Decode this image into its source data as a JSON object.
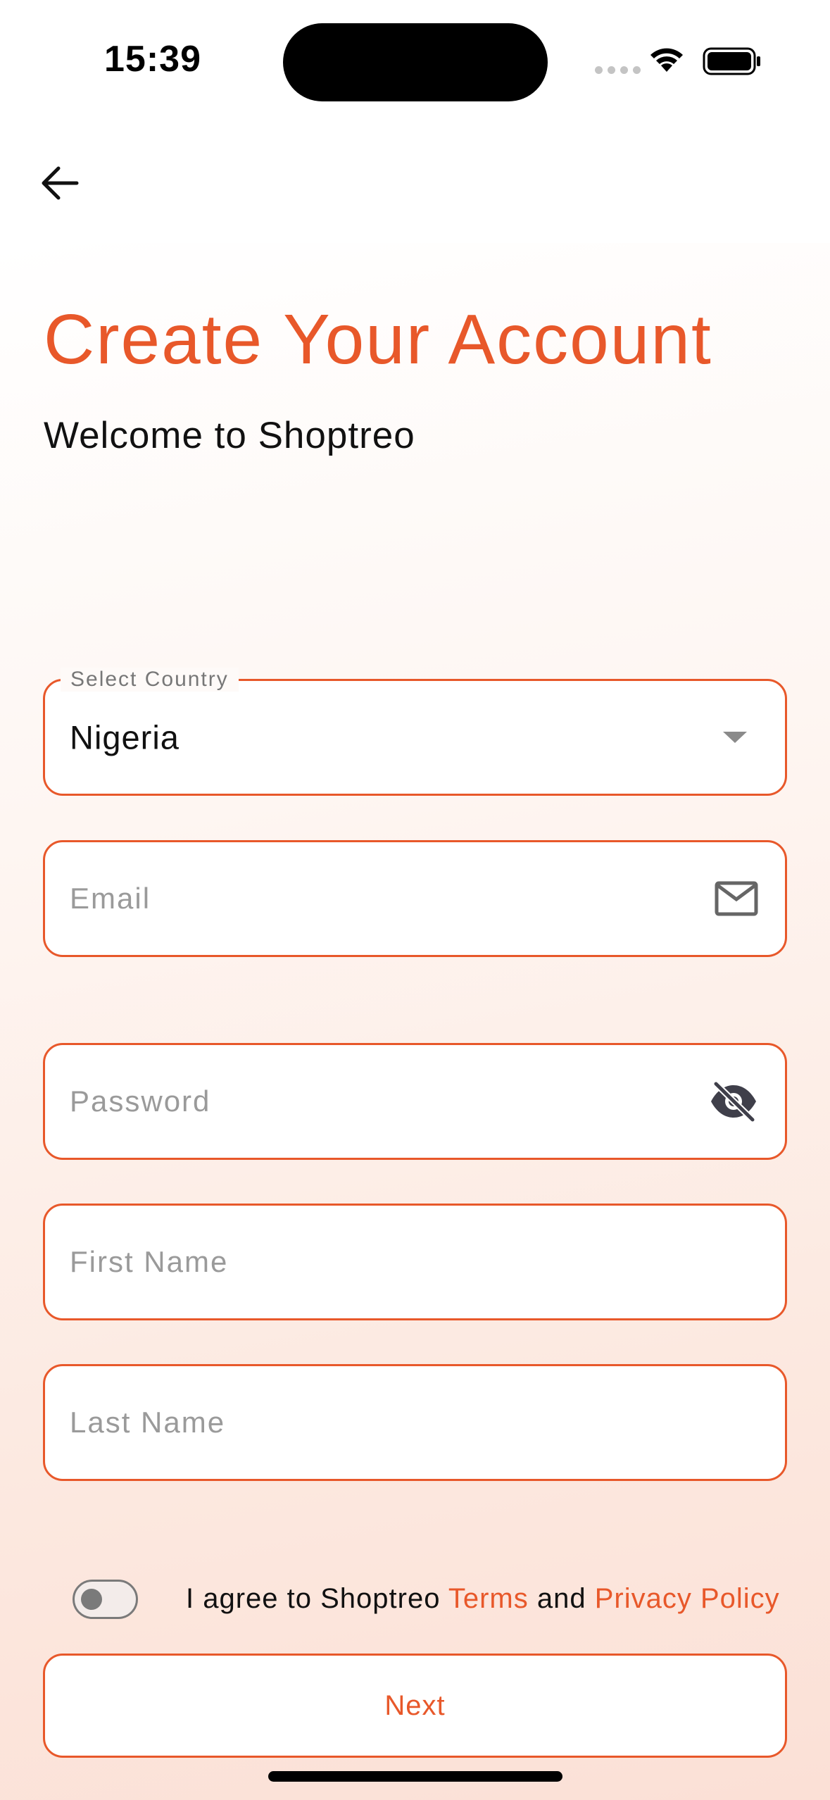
{
  "status_bar": {
    "time": "15:39"
  },
  "header": {
    "back_icon": "arrow-left-icon"
  },
  "page": {
    "title": "Create Your Account",
    "subtitle": "Welcome to Shoptreo"
  },
  "form": {
    "country": {
      "label": "Select Country",
      "value": "Nigeria",
      "icon": "chevron-down-icon"
    },
    "email": {
      "placeholder": "Email",
      "value": "",
      "icon": "mail-icon"
    },
    "password": {
      "placeholder": "Password",
      "value": "",
      "icon": "eye-off-icon"
    },
    "first_name": {
      "placeholder": "First Name",
      "value": ""
    },
    "last_name": {
      "placeholder": "Last Name",
      "value": ""
    }
  },
  "terms": {
    "toggle_on": false,
    "prefix": "I agree to Shoptreo ",
    "terms_link": "Terms",
    "middle": " and ",
    "privacy_link": "Privacy Policy"
  },
  "actions": {
    "next_label": "Next"
  },
  "colors": {
    "accent": "#e8582a",
    "placeholder": "#9a9a9a",
    "text": "#111111"
  }
}
